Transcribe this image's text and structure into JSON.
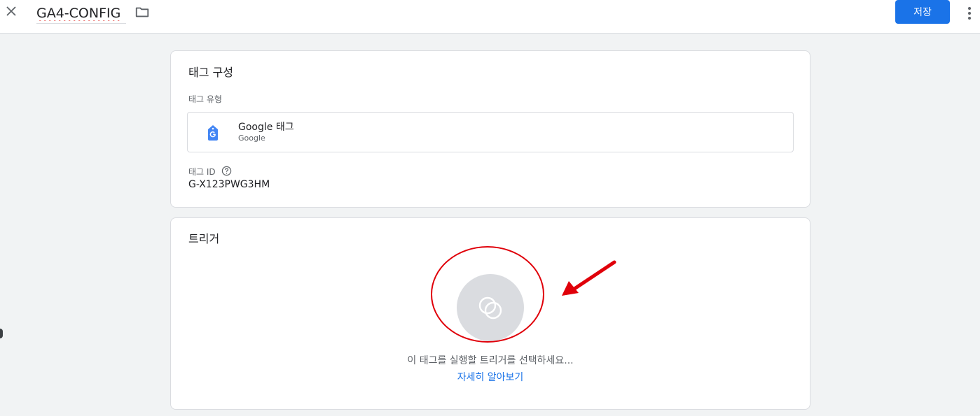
{
  "header": {
    "tag_name": "GA4-CONFIG",
    "save_label": "저장",
    "close_icon": "close-icon",
    "folder_icon": "folder-icon",
    "more_icon": "more-vert-icon",
    "accent_color": "#1a73e8"
  },
  "tag_config": {
    "title": "태그 구성",
    "type_label": "태그 유형",
    "tag_type": {
      "name": "Google 태그",
      "vendor": "Google",
      "icon": "google-tag-icon"
    },
    "id_label": "태그 ID",
    "id_help_icon": "help-icon",
    "id_value": "G-X123PWG3HM"
  },
  "triggers": {
    "title": "트리거",
    "empty_icon": "trigger-icon",
    "hint": "이 태그를 실행할 트리거를 선택하세요...",
    "learn_more": "자세히 알아보기"
  },
  "annotation": {
    "color": "#e0000a"
  }
}
